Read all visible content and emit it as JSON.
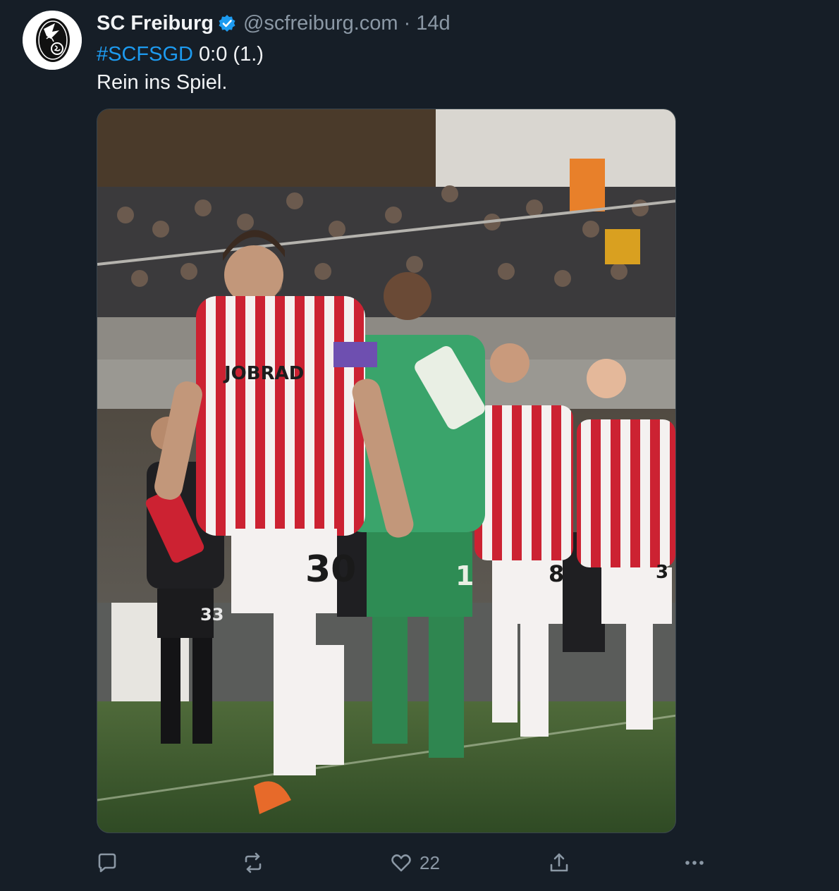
{
  "post": {
    "author": {
      "display_name": "SC Freiburg",
      "handle": "@scfreiburg.com",
      "verified": true,
      "avatar_icon": "sc-freiburg-crest-icon"
    },
    "separator": "·",
    "timestamp": "14d",
    "text": {
      "hashtag": "#SCFSGD",
      "score": " 0:0 (1.)",
      "line2": "Rein ins Spiel."
    },
    "media": {
      "type": "photo",
      "jersey_numbers": [
        "30",
        "1",
        "8",
        "3",
        "33"
      ],
      "sponsor": "JOBRAD"
    },
    "actions": {
      "reply_icon": "reply-icon",
      "repost_icon": "repost-icon",
      "like_icon": "heart-icon",
      "like_count": "22",
      "share_icon": "share-icon",
      "more_icon": "more-icon"
    }
  },
  "colors": {
    "background": "#161e27",
    "text": "#f1f3f5",
    "muted": "#8b98a5",
    "link": "#1d9bf0",
    "verified": "#1d9bf0"
  }
}
